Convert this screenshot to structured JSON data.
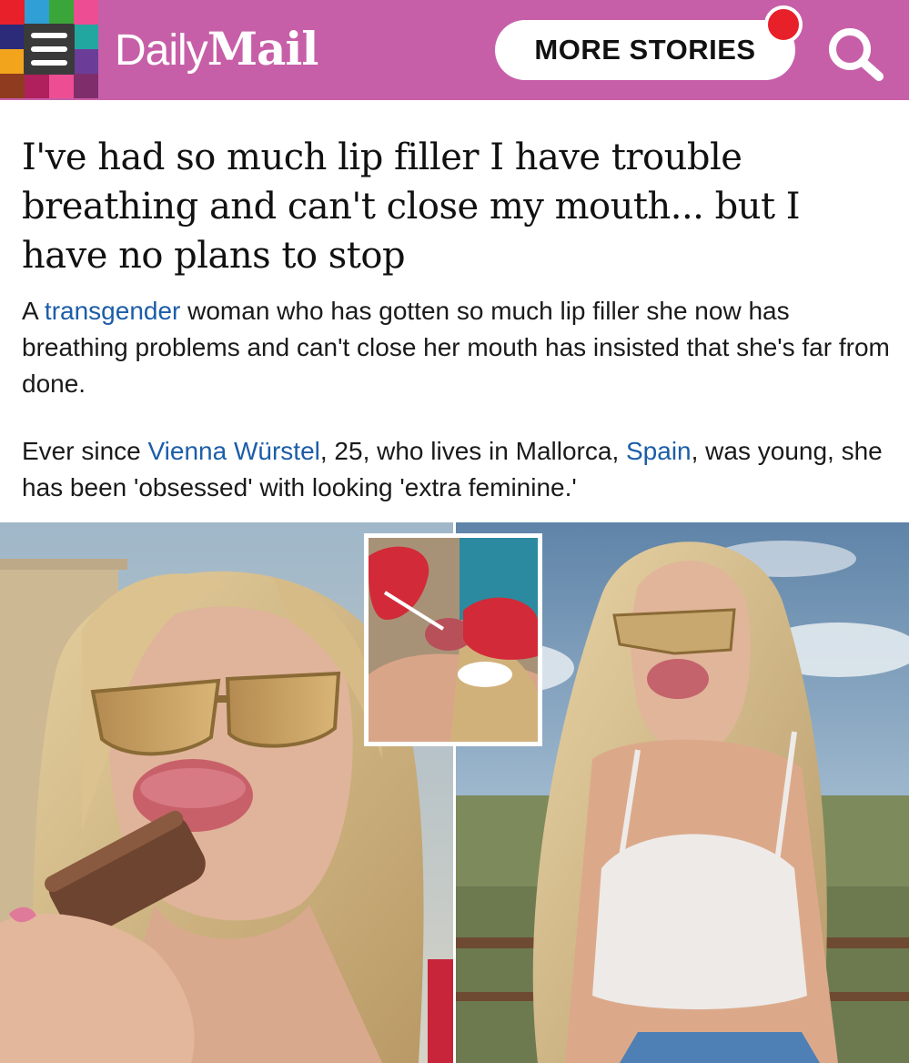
{
  "header": {
    "brand_daily": "Daily",
    "brand_mail": "Mail",
    "more_stories_label": "MORE STORIES",
    "menu_icon": "hamburger-menu-icon",
    "search_icon": "search-icon",
    "notification_icon": "notification-dot-icon",
    "colors": {
      "bar": "#c75fa8",
      "notification": "#e8202a",
      "mosaic": [
        "#e8202a",
        "#2f9fd6",
        "#3aa538",
        "#f2a51c",
        "#6b3d99",
        "#ec4d93",
        "#2b2b7a",
        "#22a7a0",
        "#8e3b1f",
        "#ffd200",
        "#b0205c",
        "#1b8e3c",
        "#e85d1c",
        "#1a6fd1",
        "#7f2e6b",
        "#c7352b"
      ]
    }
  },
  "article": {
    "headline": "I've had so much lip filler I have trouble breathing and can't close my mouth... but I have no plans to stop",
    "intro": {
      "before_link": "A ",
      "link_text": "transgender",
      "after_link": " woman who has gotten so much lip filler she now has breathing problems and can't close her mouth has insisted that she's far from done."
    },
    "second": {
      "part1": "Ever since ",
      "link1": "Vienna Würstel",
      "part2": ", 25, who lives in Mallorca, ",
      "link2": "Spain",
      "part3": ", was young, she has been 'obsessed' with looking 'extra feminine.'"
    },
    "link_color": "#1c5da8",
    "images": [
      {
        "name": "left-photo",
        "subject": "woman with sunglasses eating an ice cream bar"
      },
      {
        "name": "inset-photo",
        "subject": "lip filler injection procedure"
      },
      {
        "name": "right-photo",
        "subject": "woman in white top outdoors with sky background"
      }
    ]
  }
}
